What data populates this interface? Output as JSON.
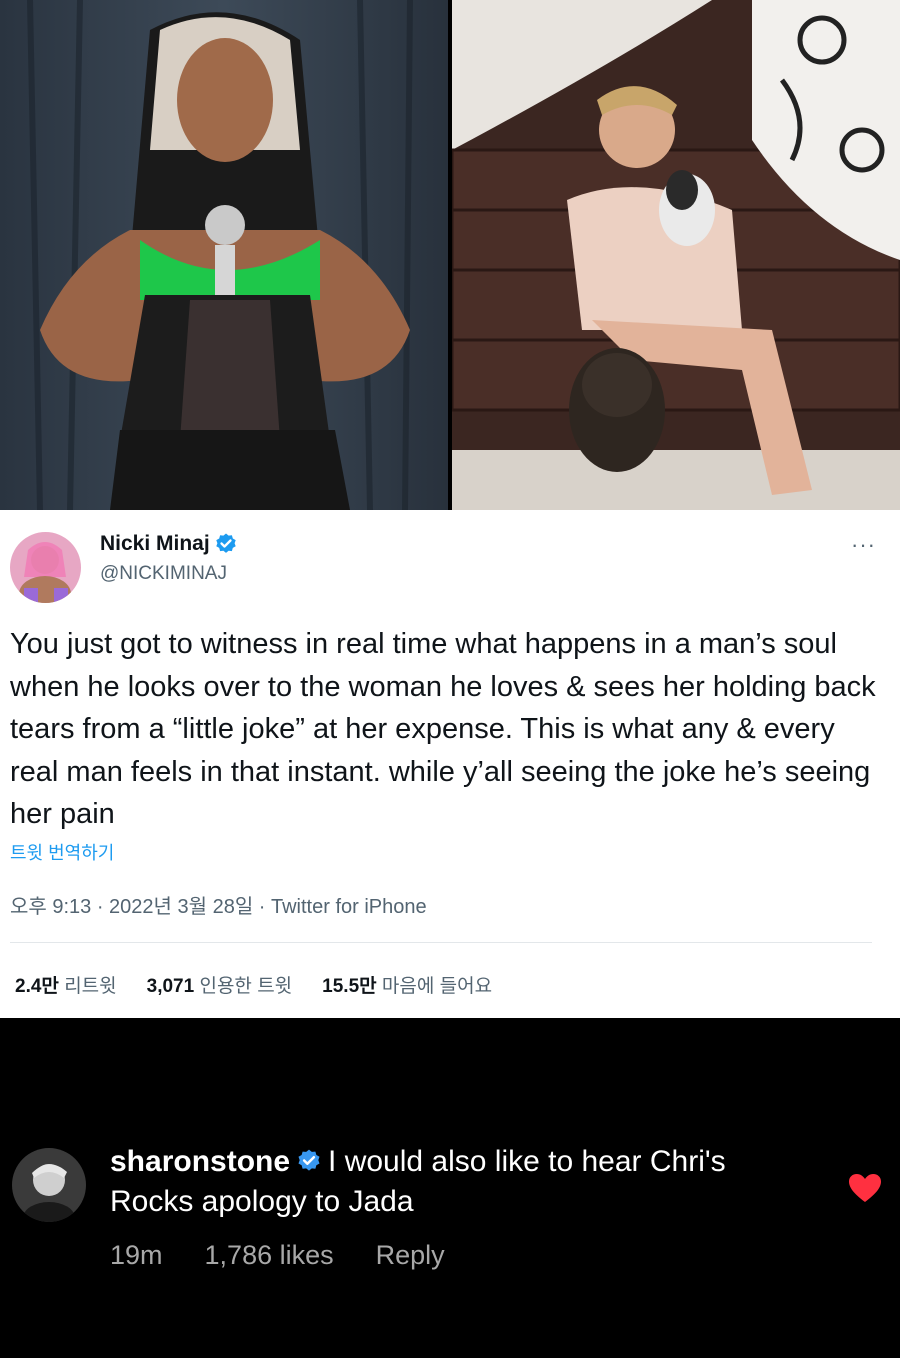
{
  "tweet": {
    "author_name": "Nicki Minaj",
    "author_handle": "@NICKIMINAJ",
    "more_label": "···",
    "text": "You just got to witness in real time what happens in a man’s soul when he looks over to the woman he loves & sees her holding back tears from a “little joke” at her expense. This is what any & every real man feels in that instant. while y’all seeing the joke he’s seeing her pain",
    "translate_label": "트윗 번역하기",
    "timestamp": "오후 9:13 · 2022년 3월 28일 · Twitter for iPhone",
    "stats": [
      {
        "value": "2.4만",
        "label": "리트윗"
      },
      {
        "value": "3,071",
        "label": "인용한 트윗"
      },
      {
        "value": "15.5만",
        "label": "마음에 들어요"
      }
    ],
    "verified_color": "#1d9bf0"
  },
  "comment": {
    "username": "sharonstone",
    "text": "I would also like to hear Chri's Rocks apology to Jada",
    "time": "19m",
    "likes": "1,786 likes",
    "reply_label": "Reply",
    "heart_color": "#ff3040",
    "verified_color": "#3897f0"
  }
}
